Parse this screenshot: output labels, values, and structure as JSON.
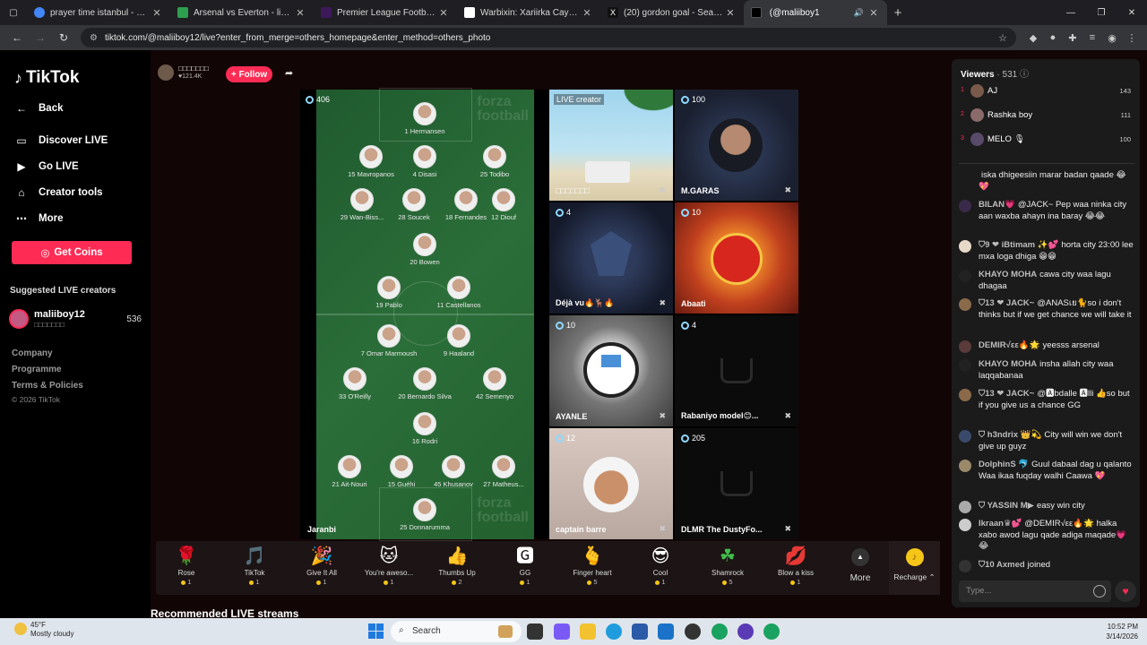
{
  "browser": {
    "tabs": [
      {
        "title": "prayer time istanbul - Google S",
        "color": "#4285f4"
      },
      {
        "title": "Arsenal vs Everton - live score,",
        "color": "#2e9e4f"
      },
      {
        "title": "Premier League Football News,",
        "color": "#3d195b"
      },
      {
        "title": "Warbixin: Xariirka Caymiska ee",
        "color": "#ffffff"
      },
      {
        "title": "(20) gordon goal - Search / X",
        "color": "#111111"
      },
      {
        "title": "⁣⁣⁣⁣⁣⁣⁣ (@maliiboy1",
        "color": "#000000"
      }
    ],
    "url": "tiktok.com/@maliiboy12/live?enter_from_merge=others_homepage&enter_method=others_photo"
  },
  "sidebar": {
    "logo": "TikTok",
    "back": "Back",
    "nav": [
      "Discover LIVE",
      "Go LIVE",
      "Creator tools",
      "More"
    ],
    "coins": "Get Coins",
    "suggested_title": "Suggested LIVE creators",
    "suggested": {
      "name": "maliiboy12",
      "sub": "□□□□□□□",
      "count": "536"
    },
    "footer": [
      "Company",
      "Programme",
      "Terms & Policies"
    ],
    "copyright": "© 2026 TikTok"
  },
  "host": {
    "name": "□□□□□□□",
    "likes": "♥121.4K",
    "follow": "+ Follow"
  },
  "lineup": {
    "viewers": "406",
    "host_label": "Jaranbi",
    "brand": "forza football",
    "players": [
      "1 Hermansen",
      "15 Mavropanos",
      "4 Disasi",
      "25 Todibo",
      "29 Wan-Biss...",
      "28 Soucek",
      "18 Fernandes",
      "12 Diouf",
      "20 Bowen",
      "19 Pablo",
      "11 Castellanos",
      "7 Omar Marmoush",
      "9 Haaland",
      "33 O'Reilly",
      "20 Bernardo Silva",
      "42 Semenyo",
      "16 Rodri",
      "21 Ait-Nouri",
      "15 Guéhi",
      "45 Khusanov",
      "27 Matheus...",
      "25 Donnarumma"
    ]
  },
  "guests": [
    {
      "name": "□□□□□□□",
      "viewers": "",
      "tag": "LIVE creator"
    },
    {
      "name": "M.GARAS",
      "viewers": "100"
    },
    {
      "name": "Déjà vu🔥🦌🔥",
      "viewers": "4"
    },
    {
      "name": "Abaati",
      "viewers": "10"
    },
    {
      "name": "AYANLE",
      "viewers": "10"
    },
    {
      "name": "Rabaniyo model😊...",
      "viewers": "4"
    },
    {
      "name": "captain barre",
      "viewers": "12"
    },
    {
      "name": "DLMR The DustyFo...",
      "viewers": "205"
    }
  ],
  "gifts": [
    {
      "icon": "🌹",
      "name": "Rose",
      "price": "1"
    },
    {
      "icon": "🎵",
      "name": "TikTok",
      "price": "1"
    },
    {
      "icon": "🎉",
      "name": "Give It All",
      "price": "1"
    },
    {
      "icon": "🐱",
      "name": "You're aweso...",
      "price": "1"
    },
    {
      "icon": "👍",
      "name": "Thumbs Up",
      "price": "2"
    },
    {
      "icon": "🅶",
      "name": "GG",
      "price": "1"
    },
    {
      "icon": "🫰",
      "name": "Finger heart",
      "price": "5"
    },
    {
      "icon": "😎",
      "name": "Cool",
      "price": "1"
    },
    {
      "icon": "☘",
      "name": "Shamrock",
      "price": "5"
    },
    {
      "icon": "💋",
      "name": "Blow a kiss",
      "price": "1"
    }
  ],
  "gift_more": "More",
  "recharge": "Recharge ⌃",
  "recommended": "Recommended LIVE streams",
  "viewers_panel": {
    "title": "Viewers",
    "count": "· 531",
    "top": [
      {
        "rank": "1",
        "name": "AJ",
        "score": "143"
      },
      {
        "rank": "2",
        "name": "Rashka boy",
        "score": "111"
      },
      {
        "rank": "3",
        "name": "MELO 🎙",
        "score": "100"
      }
    ]
  },
  "chat": [
    {
      "user": "",
      "text": "iska dhigeesiin marar badan qaade 😂💖"
    },
    {
      "user": "BILAN💗",
      "text": "@JACK~ Pep waa ninka city aan waxba ahayn ina baray 😂😂"
    },
    {
      "user": "⛉9 ❤ iBtimam ✨💕",
      "text": "horta city 23:00 lee mxa loga dhiga 😁😁"
    },
    {
      "user": "KHAYO MOHA",
      "text": "cawa city waa lagu dhagaa"
    },
    {
      "user": "⛉13 ❤ JACK~",
      "text": "@ANASเย🐈so i don't thinks but if we get chance we will take it"
    },
    {
      "user": "DEMIR√εε🔥🌟",
      "text": "yeesss arsenal"
    },
    {
      "user": "KHAYO MOHA",
      "text": "insha allah city waa laqqabanaa"
    },
    {
      "user": "⛉13 ❤ JACK~",
      "text": "@🅰bdalle 🅰lli 👍so but if you give us a chance GG"
    },
    {
      "user": "⛉ h3ndrix 👑💫",
      "text": "City will win we don't give up guyz"
    },
    {
      "user": "DolphinS 🐬",
      "text": "Guul dabaal dag u qalanto Waa ikaa fuqday walhi Caawa 💖"
    },
    {
      "user": "⛉ YASSIN M▶",
      "text": "easy win city"
    },
    {
      "user": "Ikraan♛💕",
      "text": "@DEMIR√εε🔥🌟 halka xabo awod lagu qade adiga maqade💗😂"
    },
    {
      "user": "⛉10 Axmed",
      "text": "joined"
    }
  ],
  "chat_placeholder": "Type...",
  "taskbar": {
    "temp": "45°F",
    "weather": "Mostly cloudy",
    "search": "Search",
    "time": "10:52 PM",
    "date": "3/14/2026"
  }
}
